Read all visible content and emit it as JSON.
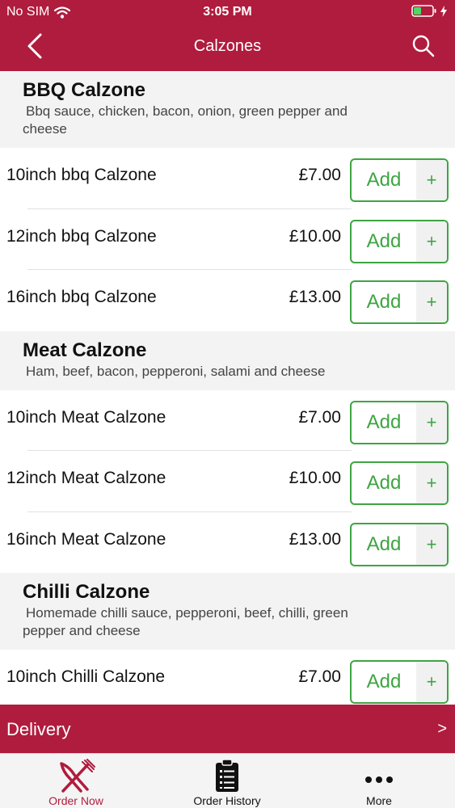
{
  "status_bar": {
    "carrier": "No SIM",
    "time": "3:05 PM"
  },
  "nav": {
    "title": "Calzones"
  },
  "sections": [
    {
      "title": "BBQ Calzone",
      "description": "Bbq sauce, chicken, bacon, onion, green pepper and cheese",
      "items": [
        {
          "name": "10inch bbq Calzone",
          "price": "£7.00",
          "add_label": "Add",
          "plus": "+"
        },
        {
          "name": "12inch bbq Calzone",
          "price": "£10.00",
          "add_label": "Add",
          "plus": "+"
        },
        {
          "name": "16inch bbq Calzone",
          "price": "£13.00",
          "add_label": "Add",
          "plus": "+"
        }
      ]
    },
    {
      "title": "Meat Calzone",
      "description": "Ham, beef, bacon, pepperoni, salami and cheese",
      "items": [
        {
          "name": "10inch Meat Calzone",
          "price": "£7.00",
          "add_label": "Add",
          "plus": "+"
        },
        {
          "name": "12inch Meat Calzone",
          "price": "£10.00",
          "add_label": "Add",
          "plus": "+"
        },
        {
          "name": "16inch Meat Calzone",
          "price": "£13.00",
          "add_label": "Add",
          "plus": "+"
        }
      ]
    },
    {
      "title": "Chilli Calzone",
      "description": "Homemade chilli sauce, pepperoni, beef, chilli, green pepper and cheese",
      "items": [
        {
          "name": "10inch Chilli Calzone",
          "price": "£7.00",
          "add_label": "Add",
          "plus": "+"
        }
      ]
    }
  ],
  "delivery": {
    "label": "Delivery",
    "arrow": ">"
  },
  "tabs": [
    {
      "label": "Order Now",
      "icon": "fork-knife-icon",
      "active": true
    },
    {
      "label": "Order History",
      "icon": "clipboard-icon",
      "active": false
    },
    {
      "label": "More",
      "icon": "more-dots-icon",
      "active": false
    }
  ],
  "colors": {
    "brand": "#b01c3e",
    "accent": "#3ea542"
  }
}
